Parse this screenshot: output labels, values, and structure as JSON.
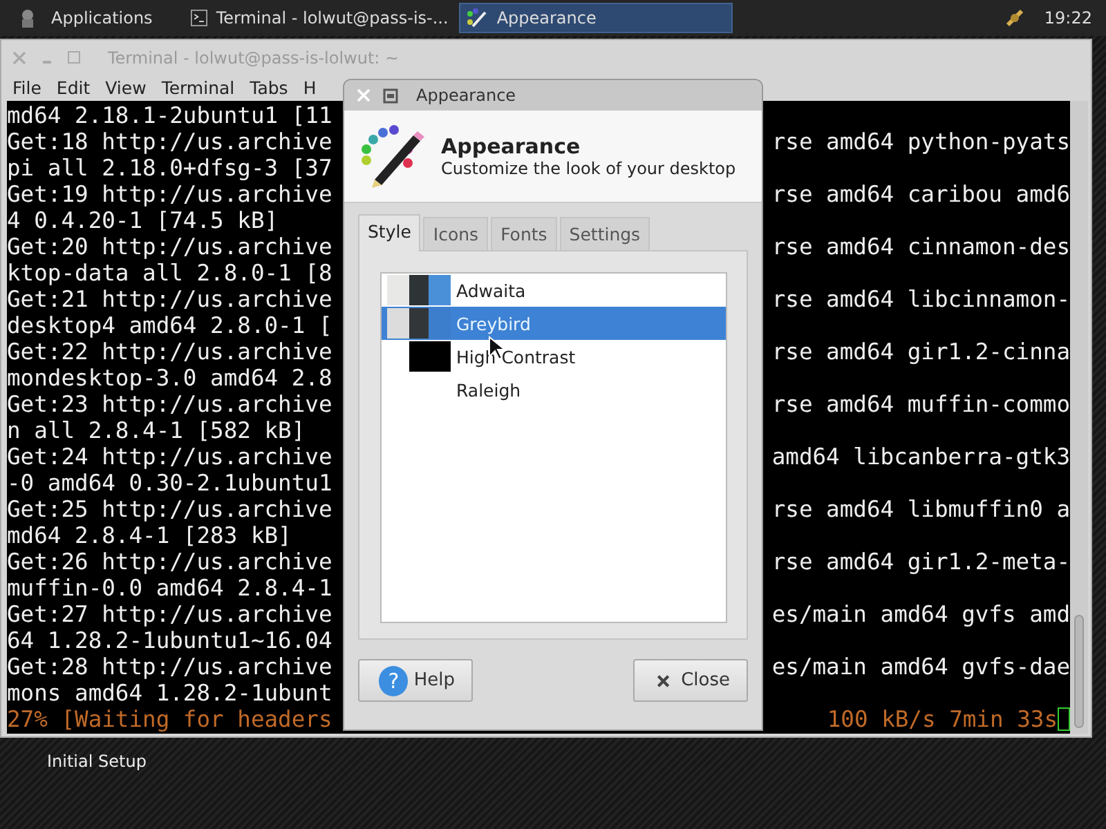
{
  "panel": {
    "menu_label": "Applications",
    "tasks": [
      {
        "label": "Terminal - lolwut@pass-is-...",
        "selected": false
      },
      {
        "label": "Appearance",
        "selected": true
      }
    ],
    "clock": "19:22"
  },
  "terminal": {
    "title": "Terminal - lolwut@pass-is-lolwut: ~",
    "menu": [
      "File",
      "Edit",
      "View",
      "Terminal",
      "Tabs",
      "H"
    ],
    "lines": [
      {
        "left": "md64 2.18.1-2ubuntu1 [11"
      },
      {
        "left": "Get:18 http://us.archive",
        "right": "rse amd64 python-pyats"
      },
      {
        "left": "pi all 2.18.0+dfsg-3 [37"
      },
      {
        "left": "Get:19 http://us.archive",
        "right": "rse amd64 caribou amd6"
      },
      {
        "left": "4 0.4.20-1 [74.5 kB]"
      },
      {
        "left": "Get:20 http://us.archive",
        "right": "rse amd64 cinnamon-des"
      },
      {
        "left": "ktop-data all 2.8.0-1 [8"
      },
      {
        "left": "Get:21 http://us.archive",
        "right": "rse amd64 libcinnamon-"
      },
      {
        "left": "desktop4 amd64 2.8.0-1 ["
      },
      {
        "left": "Get:22 http://us.archive",
        "right": "rse amd64 gir1.2-cinna"
      },
      {
        "left": "mondesktop-3.0 amd64 2.8"
      },
      {
        "left": "Get:23 http://us.archive",
        "right": "rse amd64 muffin-commo"
      },
      {
        "left": "n all 2.8.4-1 [582 kB]"
      },
      {
        "left": "Get:24 http://us.archive",
        "right": "amd64 libcanberra-gtk3"
      },
      {
        "left": "-0 amd64 0.30-2.1ubuntu1"
      },
      {
        "left": "Get:25 http://us.archive",
        "right": "rse amd64 libmuffin0 a"
      },
      {
        "left": "md64 2.8.4-1 [283 kB]"
      },
      {
        "left": "Get:26 http://us.archive",
        "right": "rse amd64 gir1.2-meta-"
      },
      {
        "left": "muffin-0.0 amd64 2.8.4-1"
      },
      {
        "left": "Get:27 http://us.archive",
        "right": "es/main amd64 gvfs amd"
      },
      {
        "left": "64 1.28.2-1ubuntu1~16.04"
      },
      {
        "left": "Get:28 http://us.archive",
        "right": "es/main amd64 gvfs-dae"
      },
      {
        "left": "mons amd64 1.28.2-1ubunt"
      }
    ],
    "progress": {
      "left": "27% [Waiting for headers",
      "right": "100 kB/s 7min 33s"
    }
  },
  "dialog": {
    "title": "Appearance",
    "heading": "Appearance",
    "subtitle": "Customize the look of your desktop",
    "tabs": [
      {
        "label": "Style",
        "selected": true
      },
      {
        "label": "Icons",
        "selected": false
      },
      {
        "label": "Fonts",
        "selected": false
      },
      {
        "label": "Settings",
        "selected": false
      }
    ],
    "themes": [
      {
        "name": "Adwaita",
        "selected": false,
        "swatches": [
          {
            "color": "#e8e8e7"
          },
          {
            "color": "#2e3436"
          },
          {
            "color": "#4a90d9"
          }
        ]
      },
      {
        "name": "Greybird",
        "selected": true,
        "swatches": [
          {
            "color": "#dcdcdc"
          },
          {
            "color": "#333639"
          },
          {
            "color": "#3d7ecc"
          }
        ]
      },
      {
        "name": "High Contrast",
        "selected": false,
        "swatches": [
          {
            "color": "#ffffff"
          },
          {
            "color": "#000000"
          },
          {
            "color": "#000000"
          }
        ]
      },
      {
        "name": "Raleigh",
        "selected": false
      }
    ],
    "buttons": [
      {
        "kind": "help",
        "label": "Help",
        "icon": "?"
      },
      {
        "kind": "close",
        "label": "Close"
      }
    ]
  },
  "desktop": {
    "icon_label": "Initial Setup"
  }
}
